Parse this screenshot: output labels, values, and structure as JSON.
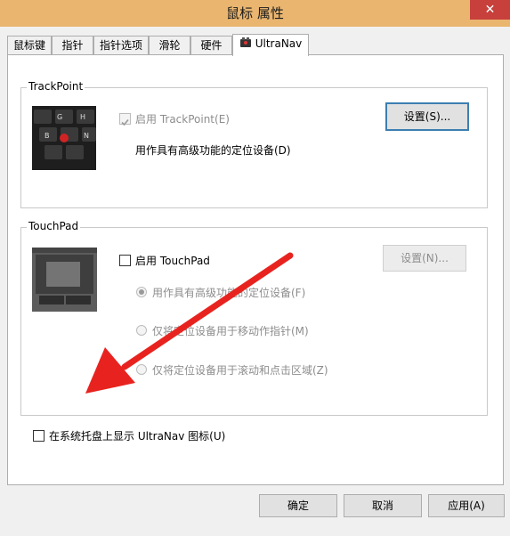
{
  "window": {
    "title": "鼠标 属性",
    "close_glyph": "✕"
  },
  "tabs": [
    {
      "label": "鼠标键",
      "active": false
    },
    {
      "label": "指针",
      "active": false
    },
    {
      "label": "指针选项",
      "active": false
    },
    {
      "label": "滑轮",
      "active": false
    },
    {
      "label": "硬件",
      "active": false
    },
    {
      "label": "UltraNav",
      "active": true
    }
  ],
  "trackpoint": {
    "group_label": "TrackPoint",
    "enable_label": "启用 TrackPoint(E)",
    "enabled": true,
    "description": "用作具有高级功能的定位设备(D)",
    "settings_button": "设置(S)..."
  },
  "touchpad": {
    "group_label": "TouchPad",
    "enable_label": "启用 TouchPad",
    "enabled": false,
    "settings_button": "设置(N)...",
    "options": [
      {
        "label": "用作具有高级功能的定位设备(F)",
        "selected": true
      },
      {
        "label": "仅将定位设备用于移动作指针(M)",
        "selected": false
      },
      {
        "label": "仅将定位设备用于滚动和点击区域(Z)",
        "selected": false
      }
    ]
  },
  "tray": {
    "label": "在系统托盘上显示 UltraNav 图标(U)",
    "checked": false
  },
  "footer": {
    "ok": "确定",
    "cancel": "取消",
    "apply": "应用(A)"
  },
  "icons": {
    "close": "close-icon",
    "ultranav": "ultranav-icon",
    "trackpoint_image": "trackpoint-keyboard-image",
    "touchpad_image": "touchpad-image",
    "annotation": "red-arrow-annotation"
  },
  "colors": {
    "titlebar": "#e9b56f",
    "close": "#c7403c",
    "arrow": "#e8231f",
    "focus": "#3c7fb1"
  }
}
